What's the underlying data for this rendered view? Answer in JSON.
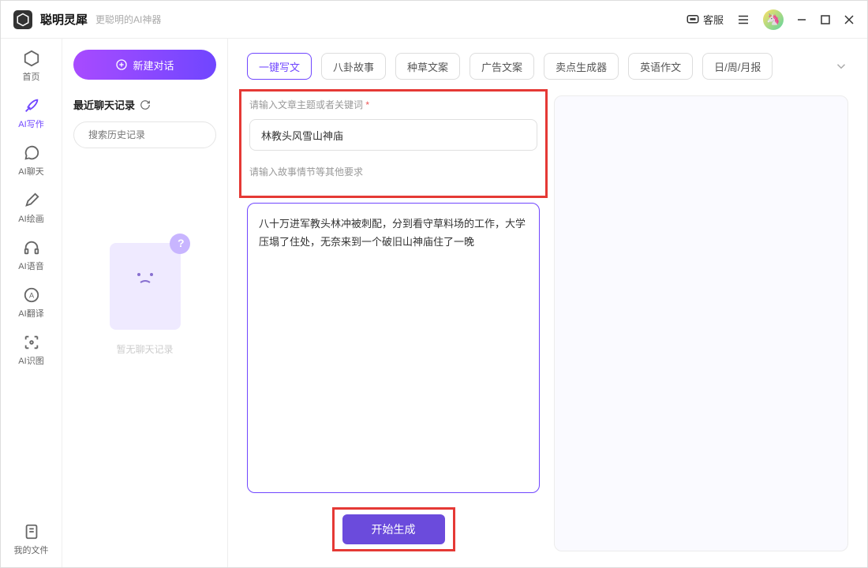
{
  "header": {
    "app_title": "聪明灵犀",
    "app_subtitle": "更聪明的AI神器",
    "service_label": "客服"
  },
  "sidebar": {
    "items": [
      {
        "label": "首页"
      },
      {
        "label": "AI写作"
      },
      {
        "label": "AI聊天"
      },
      {
        "label": "AI绘画"
      },
      {
        "label": "AI语音"
      },
      {
        "label": "AI翻译"
      },
      {
        "label": "AI识图"
      }
    ],
    "bottom_label": "我的文件"
  },
  "secondary": {
    "new_chat_label": "新建对话",
    "recent_header": "最近聊天记录",
    "search_placeholder": "搜索历史记录",
    "empty_text": "暂无聊天记录"
  },
  "tabs": [
    "一键写文",
    "八卦故事",
    "种草文案",
    "广告文案",
    "卖点生成器",
    "英语作文",
    "日/周/月报"
  ],
  "form": {
    "topic_label": "请输入文章主题或者关键词",
    "topic_value": "林教头风雪山神庙",
    "detail_label": "请输入故事情节等其他要求",
    "detail_value": "八十万进军教头林冲被刺配，分到看守草料场的工作，大学压塌了住处，无奈来到一个破旧山神庙住了一晚",
    "generate_label": "开始生成"
  }
}
